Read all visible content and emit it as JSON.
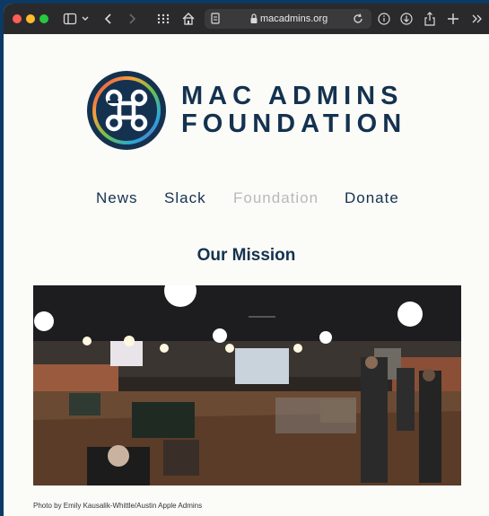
{
  "browser": {
    "url": "macadmins.org",
    "colors": {
      "close": "#ff5f57",
      "minimize": "#febc2e",
      "zoom": "#28c840",
      "toolbar": "#2a2a2c"
    },
    "icons": [
      "sidebar-icon",
      "chevron-down-icon",
      "back-icon",
      "forward-icon",
      "grid-icon",
      "home-icon",
      "reader-icon",
      "lock-icon",
      "reload-icon",
      "info-icon",
      "download-icon",
      "share-icon",
      "new-tab-icon",
      "more-icon"
    ]
  },
  "site": {
    "brand_line1": "MAC ADMINS",
    "brand_line2": "FOUNDATION",
    "logo_icon": "command-key-icon",
    "nav": [
      {
        "label": "News",
        "active": false
      },
      {
        "label": "Slack",
        "active": false
      },
      {
        "label": "Foundation",
        "active": true
      },
      {
        "label": "Donate",
        "active": false
      }
    ],
    "colors": {
      "navy": "#14324f",
      "muted": "#b9b9b9",
      "accent_teal": "#18a5a8"
    },
    "mission_heading": "Our Mission",
    "photo_caption": "Photo by Emily Kausalik-Whittle/Austin Apple Admins"
  }
}
